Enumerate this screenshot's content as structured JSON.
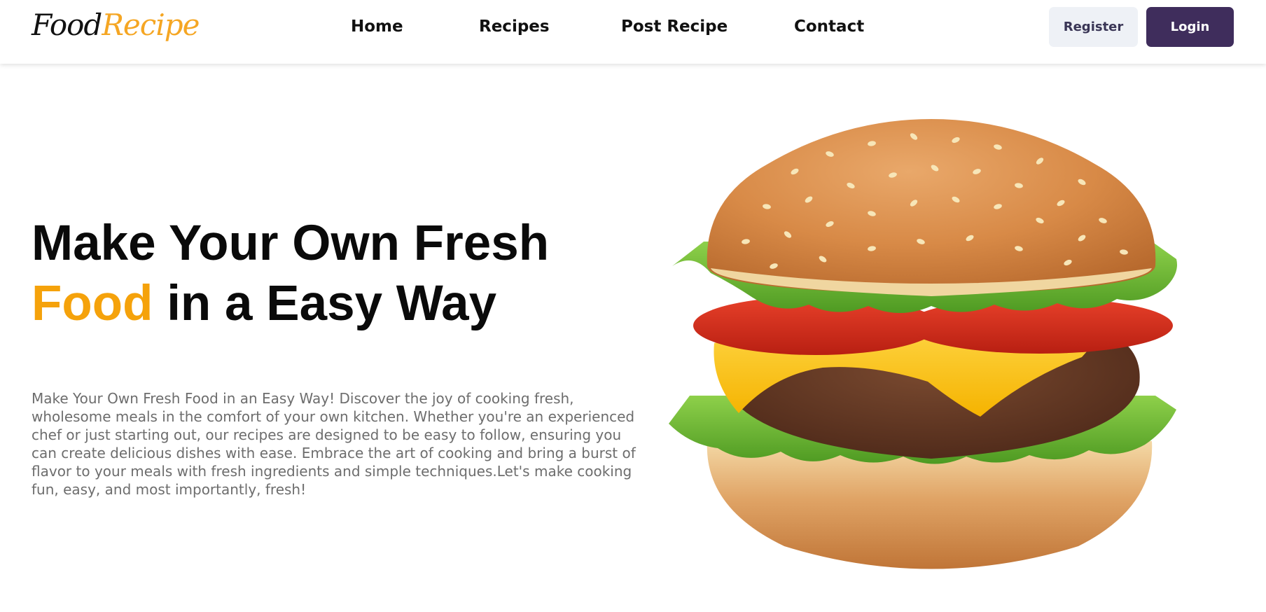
{
  "header": {
    "logo": {
      "part1": "Food",
      "part2": "Recipe"
    },
    "nav": [
      {
        "label": "Home"
      },
      {
        "label": "Recipes"
      },
      {
        "label": "Post Recipe"
      },
      {
        "label": "Contact"
      }
    ],
    "register_label": "Register",
    "login_label": "Login"
  },
  "hero": {
    "title_line1": "Make Your Own Fresh",
    "title_accent": "Food",
    "title_line2_rest": " in a Easy Way",
    "description": "Make Your Own Fresh Food in an Easy Way! Discover the joy of cooking fresh, wholesome meals in the comfort of your own kitchen. Whether you're an experienced chef or just starting out, our recipes are designed to be easy to follow, ensuring you can create delicious dishes with ease. Embrace the art of cooking and bring a burst of flavor to your meals with fresh ingredients and simple techniques.Let's make cooking fun, easy, and most importantly, fresh!",
    "image": "burger-image"
  },
  "colors": {
    "accent": "#f5a20b",
    "login_bg": "#3f2d5c",
    "register_bg": "#eef1f6",
    "text_muted": "#6d6d6d"
  }
}
